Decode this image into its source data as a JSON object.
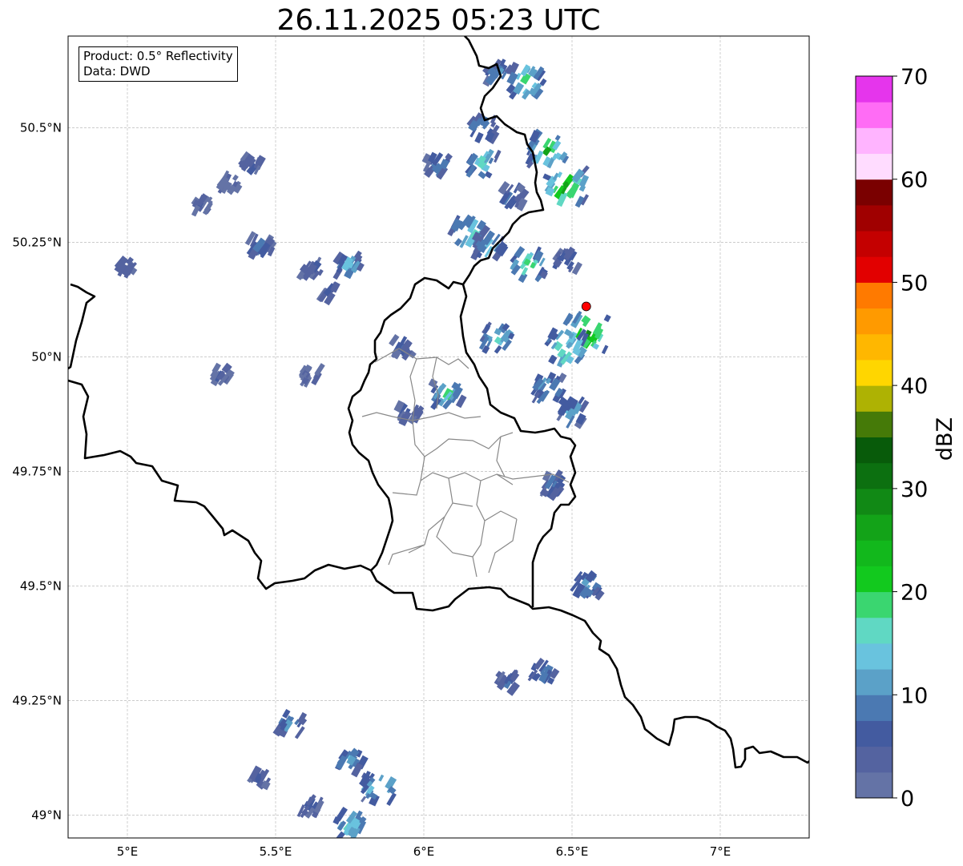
{
  "title": "26.11.2025 05:23 UTC",
  "info": {
    "product_line": "Product: 0.5° Reflectivity",
    "data_line": "Data: DWD"
  },
  "map": {
    "lon_range": [
      4.8,
      7.3
    ],
    "lat_range": [
      48.95,
      50.7
    ],
    "lon_ticks": [
      {
        "value": 5.0,
        "label": "5°E"
      },
      {
        "value": 5.5,
        "label": "5.5°E"
      },
      {
        "value": 6.0,
        "label": "6°E"
      },
      {
        "value": 6.5,
        "label": "6.5°E"
      },
      {
        "value": 7.0,
        "label": "7°E"
      }
    ],
    "lat_ticks": [
      {
        "value": 49.0,
        "label": "49°N"
      },
      {
        "value": 49.25,
        "label": "49.25°N"
      },
      {
        "value": 49.5,
        "label": "49.5°N"
      },
      {
        "value": 49.75,
        "label": "49.75°N"
      },
      {
        "value": 50.0,
        "label": "50°N"
      },
      {
        "value": 50.25,
        "label": "50.25°N"
      },
      {
        "value": 50.5,
        "label": "50.5°N"
      }
    ],
    "grid": true,
    "radar_site": {
      "lon": 6.548,
      "lat": 50.11,
      "color": "#ff0000"
    },
    "echoes": [
      {
        "lon": 6.25,
        "lat": 50.62,
        "dbz": 12
      },
      {
        "lon": 6.35,
        "lat": 50.6,
        "dbz": 22
      },
      {
        "lon": 6.2,
        "lat": 50.5,
        "dbz": 14
      },
      {
        "lon": 6.42,
        "lat": 50.45,
        "dbz": 25
      },
      {
        "lon": 6.48,
        "lat": 50.37,
        "dbz": 28
      },
      {
        "lon": 6.2,
        "lat": 50.42,
        "dbz": 18
      },
      {
        "lon": 6.05,
        "lat": 50.42,
        "dbz": 12
      },
      {
        "lon": 6.3,
        "lat": 50.35,
        "dbz": 10
      },
      {
        "lon": 6.15,
        "lat": 50.27,
        "dbz": 20
      },
      {
        "lon": 6.22,
        "lat": 50.24,
        "dbz": 16
      },
      {
        "lon": 6.35,
        "lat": 50.2,
        "dbz": 22
      },
      {
        "lon": 6.48,
        "lat": 50.21,
        "dbz": 10
      },
      {
        "lon": 6.55,
        "lat": 50.05,
        "dbz": 30
      },
      {
        "lon": 6.48,
        "lat": 50.02,
        "dbz": 24
      },
      {
        "lon": 6.25,
        "lat": 50.04,
        "dbz": 18
      },
      {
        "lon": 6.42,
        "lat": 49.93,
        "dbz": 16
      },
      {
        "lon": 6.5,
        "lat": 49.88,
        "dbz": 14
      },
      {
        "lon": 6.44,
        "lat": 49.72,
        "dbz": 10
      },
      {
        "lon": 6.08,
        "lat": 49.92,
        "dbz": 18
      },
      {
        "lon": 5.95,
        "lat": 49.88,
        "dbz": 8
      },
      {
        "lon": 5.93,
        "lat": 50.02,
        "dbz": 8
      },
      {
        "lon": 5.42,
        "lat": 50.42,
        "dbz": 6
      },
      {
        "lon": 5.35,
        "lat": 50.38,
        "dbz": 5
      },
      {
        "lon": 5.25,
        "lat": 50.33,
        "dbz": 5
      },
      {
        "lon": 5.0,
        "lat": 50.2,
        "dbz": 5
      },
      {
        "lon": 5.62,
        "lat": 50.19,
        "dbz": 7
      },
      {
        "lon": 5.75,
        "lat": 50.2,
        "dbz": 14
      },
      {
        "lon": 5.45,
        "lat": 50.24,
        "dbz": 10
      },
      {
        "lon": 5.68,
        "lat": 50.14,
        "dbz": 5
      },
      {
        "lon": 5.62,
        "lat": 49.96,
        "dbz": 5
      },
      {
        "lon": 5.32,
        "lat": 49.96,
        "dbz": 5
      },
      {
        "lon": 6.55,
        "lat": 49.5,
        "dbz": 14
      },
      {
        "lon": 6.4,
        "lat": 49.31,
        "dbz": 12
      },
      {
        "lon": 6.28,
        "lat": 49.29,
        "dbz": 8
      },
      {
        "lon": 5.55,
        "lat": 49.2,
        "dbz": 12
      },
      {
        "lon": 5.75,
        "lat": 49.12,
        "dbz": 14
      },
      {
        "lon": 5.85,
        "lat": 49.06,
        "dbz": 20
      },
      {
        "lon": 5.62,
        "lat": 49.02,
        "dbz": 8
      },
      {
        "lon": 5.75,
        "lat": 48.98,
        "dbz": 18
      },
      {
        "lon": 5.45,
        "lat": 49.08,
        "dbz": 5
      }
    ]
  },
  "colorbar": {
    "label": "dBZ",
    "min": 0,
    "max": 70,
    "step": 2.5,
    "ticks": [
      {
        "value": 0,
        "label": "0"
      },
      {
        "value": 10,
        "label": "10"
      },
      {
        "value": 20,
        "label": "20"
      },
      {
        "value": 30,
        "label": "30"
      },
      {
        "value": 40,
        "label": "40"
      },
      {
        "value": 50,
        "label": "50"
      },
      {
        "value": 60,
        "label": "60"
      },
      {
        "value": 70,
        "label": "70"
      }
    ],
    "colors": [
      "#6473a6",
      "#5463a0",
      "#435ba0",
      "#4b79b2",
      "#5ba1c8",
      "#69c3de",
      "#60d8c3",
      "#3ad670",
      "#12c91e",
      "#12b81c",
      "#13a318",
      "#118915",
      "#0c7010",
      "#085b0a",
      "#457a08",
      "#aeb203",
      "#ffd600",
      "#ffb700",
      "#ff9a00",
      "#ff7a00",
      "#e20000",
      "#c40000",
      "#a00000",
      "#7a0000",
      "#ffdcff",
      "#ffb4ff",
      "#ff6cf5",
      "#e535ec"
    ]
  }
}
